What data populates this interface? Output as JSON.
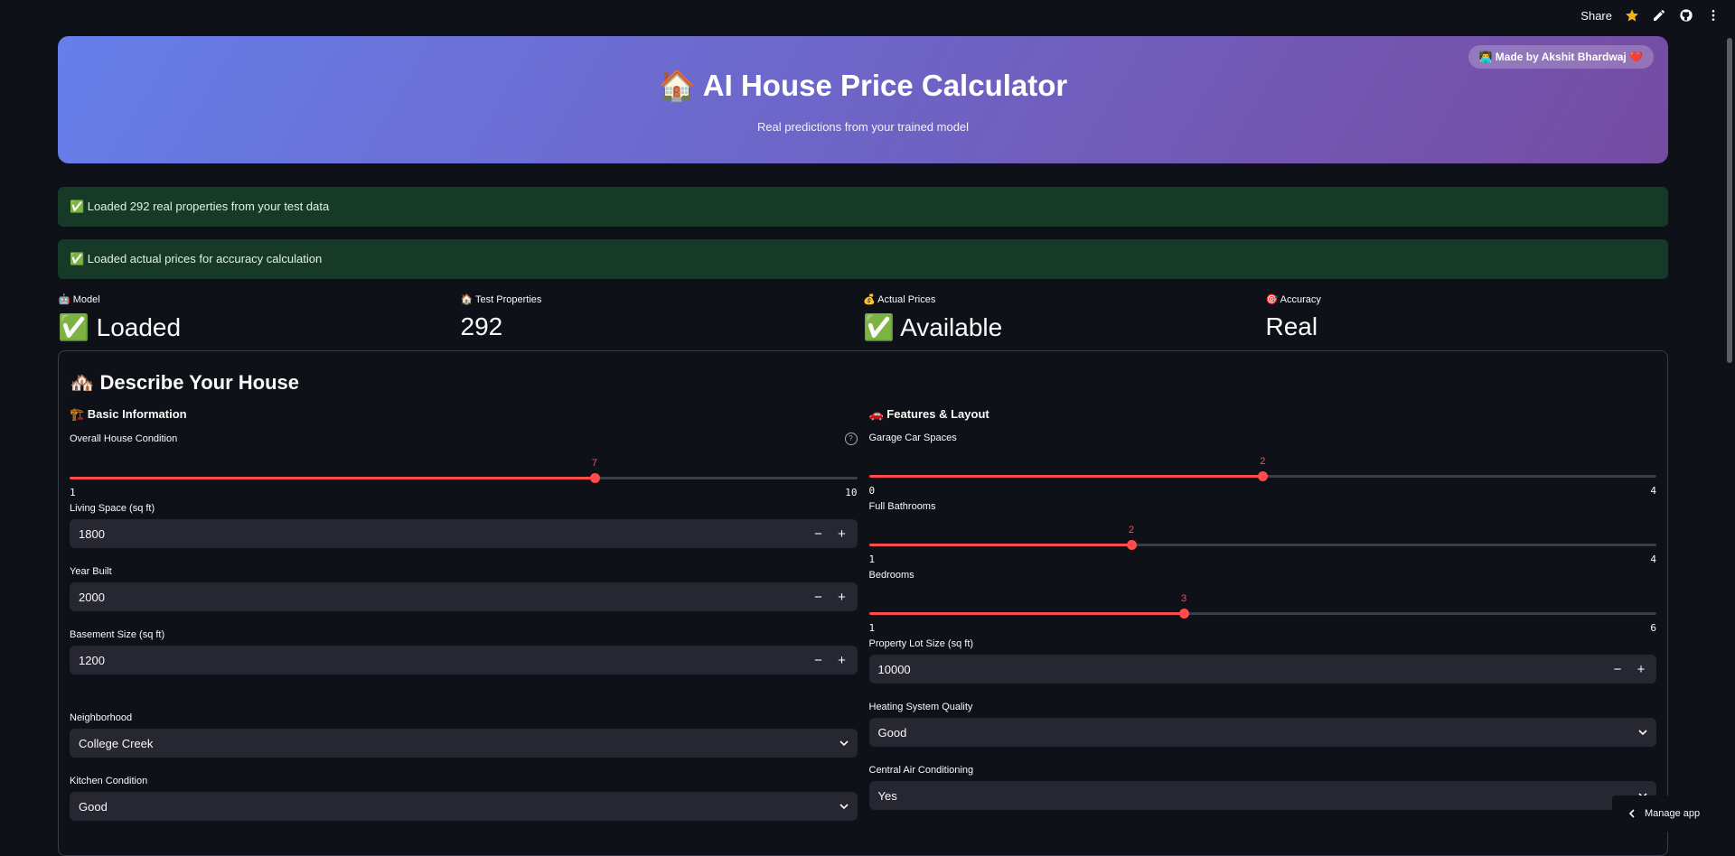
{
  "toolbar": {
    "share_label": "Share",
    "icons": [
      "star-icon",
      "pencil-icon",
      "github-icon",
      "kebab-menu-icon"
    ]
  },
  "hero": {
    "badge": "👨‍💻 Made by Akshit Bhardwaj ❤️",
    "title": "🏠 AI House Price Calculator",
    "subtitle": "Real predictions from your trained model",
    "gradient": [
      "#667eea",
      "#764ba2"
    ]
  },
  "alerts": [
    "✅ Loaded 292 real properties from your test data",
    "✅ Loaded actual prices for accuracy calculation"
  ],
  "metrics": [
    {
      "label": "🤖 Model",
      "value": "✅ Loaded"
    },
    {
      "label": "🏠 Test Properties",
      "value": "292"
    },
    {
      "label": "💰 Actual Prices",
      "value": "✅ Available"
    },
    {
      "label": "🎯 Accuracy",
      "value": "Real"
    }
  ],
  "form": {
    "title": "🏘️ Describe Your House",
    "left": {
      "section": "🏗️ Basic Information",
      "condition": {
        "label": "Overall House Condition",
        "value": 7,
        "min": 1,
        "max": 10,
        "value_text": "7",
        "min_text": "1",
        "max_text": "10"
      },
      "living": {
        "label": "Living Space (sq ft)",
        "value": "1800"
      },
      "year": {
        "label": "Year Built",
        "value": "2000"
      },
      "basement": {
        "label": "Basement Size (sq ft)",
        "value": "1200"
      },
      "neighborhood": {
        "label": "Neighborhood",
        "value": "College Creek"
      },
      "kitchen": {
        "label": "Kitchen Condition",
        "value": "Good"
      }
    },
    "right": {
      "section": "🚗 Features & Layout",
      "garage": {
        "label": "Garage Car Spaces",
        "value": 2,
        "min": 0,
        "max": 4,
        "value_text": "2",
        "min_text": "0",
        "max_text": "4"
      },
      "bath": {
        "label": "Full Bathrooms",
        "value": 2,
        "min": 1,
        "max": 4,
        "value_text": "2",
        "min_text": "1",
        "max_text": "4"
      },
      "bed": {
        "label": "Bedrooms",
        "value": 3,
        "min": 1,
        "max": 6,
        "value_text": "3",
        "min_text": "1",
        "max_text": "6"
      },
      "lot": {
        "label": "Property Lot Size (sq ft)",
        "value": "10000"
      },
      "heating": {
        "label": "Heating System Quality",
        "value": "Good"
      },
      "ac": {
        "label": "Central Air Conditioning",
        "value": "Yes"
      }
    }
  },
  "stepper": {
    "minus": "−",
    "plus": "+"
  },
  "manage_app": "Manage app",
  "colors": {
    "accent": "#ff4b4b",
    "background": "#0e1117",
    "input": "#262730",
    "success_bg": "#173928"
  }
}
